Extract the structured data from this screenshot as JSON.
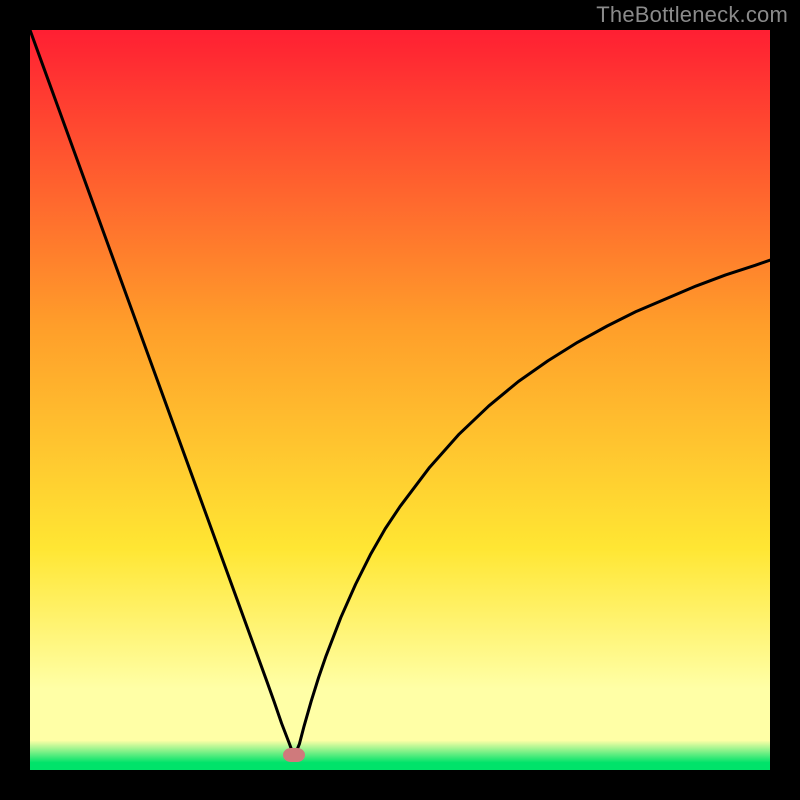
{
  "watermark": "TheBottleneck.com",
  "chart_data": {
    "type": "line",
    "title": "",
    "xlabel": "",
    "ylabel": "",
    "xlim": [
      0,
      100
    ],
    "ylim": [
      0,
      100
    ],
    "grid": false,
    "legend": false,
    "background_gradient": {
      "top": "#ff1f33",
      "mid_upper": "#ff9e2a",
      "mid": "#ffe633",
      "band": "#ffffa6",
      "bottom": "#00e36a"
    },
    "minimum_marker": {
      "x": 35.7,
      "y": 2.0,
      "color": "#cf7a7c"
    },
    "x": [
      0,
      2,
      4,
      6,
      8,
      10,
      12,
      14,
      16,
      18,
      20,
      22,
      24,
      26,
      28,
      30,
      32,
      33,
      34,
      35,
      35.7,
      36.4,
      37,
      38,
      39,
      40,
      42,
      44,
      46,
      48,
      50,
      54,
      58,
      62,
      66,
      70,
      74,
      78,
      82,
      86,
      90,
      94,
      98,
      100
    ],
    "values": [
      100,
      94.5,
      89,
      83.5,
      78,
      72.5,
      67,
      61.5,
      56,
      50.5,
      45,
      39.5,
      34,
      28.5,
      23,
      17.5,
      12,
      9.2,
      6.3,
      3.7,
      1.8,
      3.5,
      5.8,
      9.3,
      12.5,
      15.4,
      20.6,
      25.1,
      29.1,
      32.6,
      35.6,
      40.9,
      45.4,
      49.2,
      52.5,
      55.3,
      57.8,
      60.0,
      62.0,
      63.7,
      65.4,
      66.9,
      68.2,
      68.9
    ]
  }
}
